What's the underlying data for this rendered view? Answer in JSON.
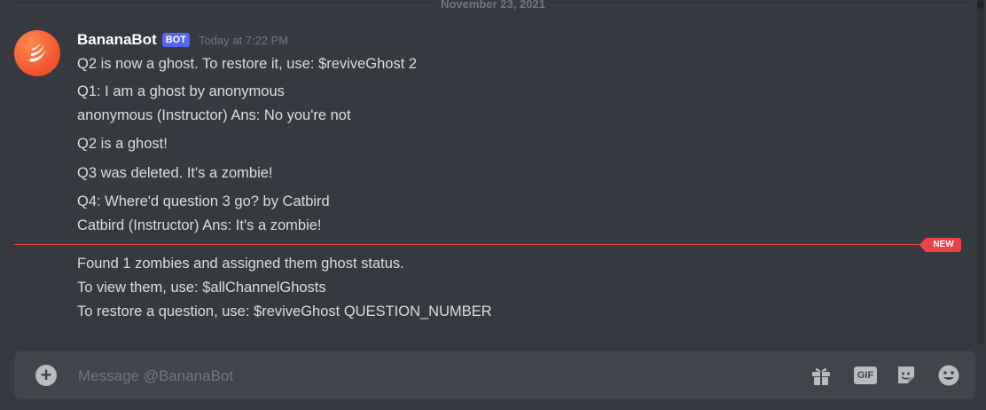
{
  "date_divider": "November 23, 2021",
  "message": {
    "username": "BananaBot",
    "tag": "BOT",
    "timestamp": "Today at 7:22 PM",
    "lines": [
      "Q2 is now a ghost. To restore it, use: $reviveGhost 2",
      "Q1: I am a ghost by anonymous",
      "anonymous (Instructor) Ans: No you're not",
      "Q2 is a ghost!",
      "Q3 was deleted. It's a zombie!",
      "Q4: Where'd question 3 go? by Catbird",
      "Catbird (Instructor) Ans: It's a zombie!"
    ],
    "after_new": [
      "Found 1 zombies and assigned them ghost status.",
      "To view them, use: $allChannelGhosts",
      "To restore a question, use: $reviveGhost QUESTION_NUMBER"
    ]
  },
  "new_badge": "NEW",
  "composer": {
    "placeholder": "Message @BananaBot",
    "gif_label": "GIF",
    "icons": [
      "plus-circle-icon",
      "gift-icon",
      "gif-icon",
      "sticker-icon",
      "emoji-icon"
    ]
  },
  "colors": {
    "background": "#36393f",
    "bot_tag": "#5865f2",
    "new_line": "#ed4245",
    "composer": "#40444b"
  }
}
